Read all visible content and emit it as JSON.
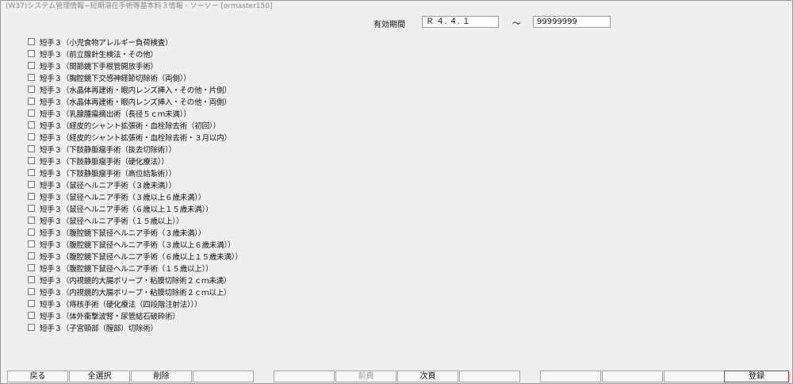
{
  "window": {
    "title": "(W37)システム管理情報−短期滞在手術等基本料３情報 - ソーソー [ormaster150]"
  },
  "period": {
    "label": "有効期間",
    "start": "Ｒ ４. ４. １",
    "separator": "〜",
    "end": "99999999"
  },
  "items": [
    "短手３（小児食物アレルギー負荷検査）",
    "短手３（前立腺針生検法・その他）",
    "短手３（関節鏡下手根管開放手術）",
    "短手３（胸腔鏡下交感神経節切除術（両側））",
    "短手３（水晶体再建術・眼内レンズ挿入・その他・片側）",
    "短手３（水晶体再建術・眼内レンズ挿入・その他・両側）",
    "短手３（乳腺腫瘍摘出術（長径５ｃｍ未満））",
    "短手３（経皮的シャント拡張術・血栓除去術（初回））",
    "短手３（経皮的シャント拡張術・血栓除去術・３月以内）",
    "短手３（下肢静脈瘤手術（抜去切除術））",
    "短手３（下肢静脈瘤手術（硬化療法））",
    "短手３（下肢静脈瘤手術（高位結紮術））",
    "短手３（鼠径ヘルニア手術（３歳未満））",
    "短手３（鼠径ヘルニア手術（３歳以上６歳未満））",
    "短手３（鼠径ヘルニア手術（６歳以上１５歳未満））",
    "短手３（鼠径ヘルニア手術（１５歳以上））",
    "短手３（腹腔鏡下鼠径ヘルニア手術（３歳未満））",
    "短手３（腹腔鏡下鼠径ヘルニア手術（３歳以上６歳未満））",
    "短手３（腹腔鏡下鼠径ヘルニア手術（６歳以上１５歳未満））",
    "短手３（腹腔鏡下鼠径ヘルニア手術（１５歳以上））",
    "短手３（内視鏡的大腸ポリープ・粘膜切除術２ｃｍ未満）",
    "短手３（内視鏡的大腸ポリープ・粘膜切除術２ｃｍ以上）",
    "短手３（痔核手術（硬化療法（四段階注射法）））",
    "短手３（体外衝撃波腎・尿管結石破砕術）",
    "短手３（子宮頸部（膣部）切除術）"
  ],
  "toolbar": {
    "back": "戻る",
    "select_all": "全選択",
    "delete": "削除",
    "prev_page": "前頁",
    "next_page": "次頁",
    "register": "登録"
  }
}
